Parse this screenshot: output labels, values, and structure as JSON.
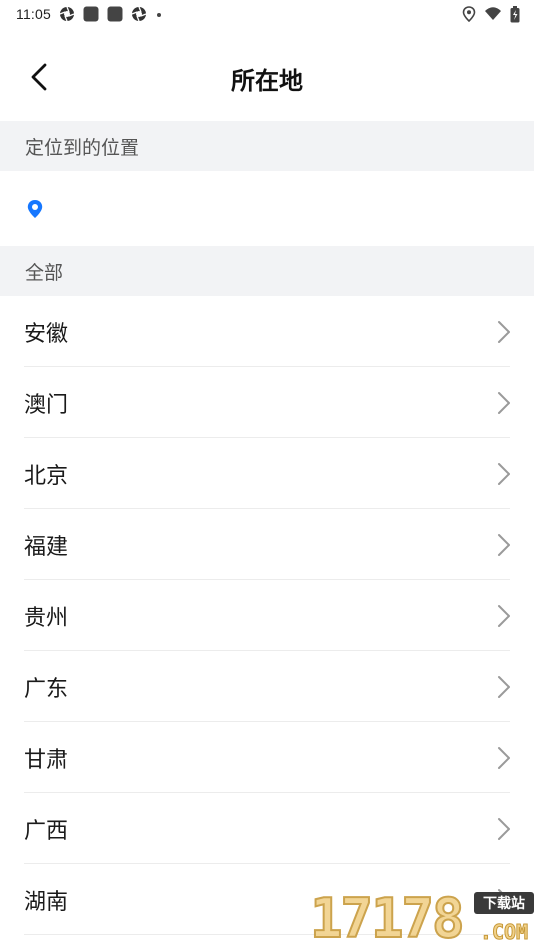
{
  "status_bar": {
    "time": "11:05",
    "icons": [
      "aperture-icon",
      "app-square-icon",
      "app-square-icon",
      "aperture-icon",
      "dot-icon"
    ],
    "right_icons": [
      "location-icon",
      "wifi-icon",
      "battery-icon"
    ]
  },
  "header": {
    "title": "所在地",
    "back_icon": "chevron-left-icon"
  },
  "sections": {
    "located": "定位到的位置",
    "all": "全部"
  },
  "located_row": {
    "icon": "location-pin-icon",
    "value": ""
  },
  "regions": [
    {
      "label": "安徽"
    },
    {
      "label": "澳门"
    },
    {
      "label": "北京"
    },
    {
      "label": "福建"
    },
    {
      "label": "贵州"
    },
    {
      "label": "广东"
    },
    {
      "label": "甘肃"
    },
    {
      "label": "广西"
    },
    {
      "label": "湖南"
    }
  ],
  "watermark": {
    "digits": "17178",
    "badge": "下载站",
    "domain": ".COM"
  },
  "colors": {
    "accent": "#1677ff",
    "section_bg": "#f2f3f5",
    "chevron": "#9a9a9a",
    "divider": "#ececec"
  }
}
